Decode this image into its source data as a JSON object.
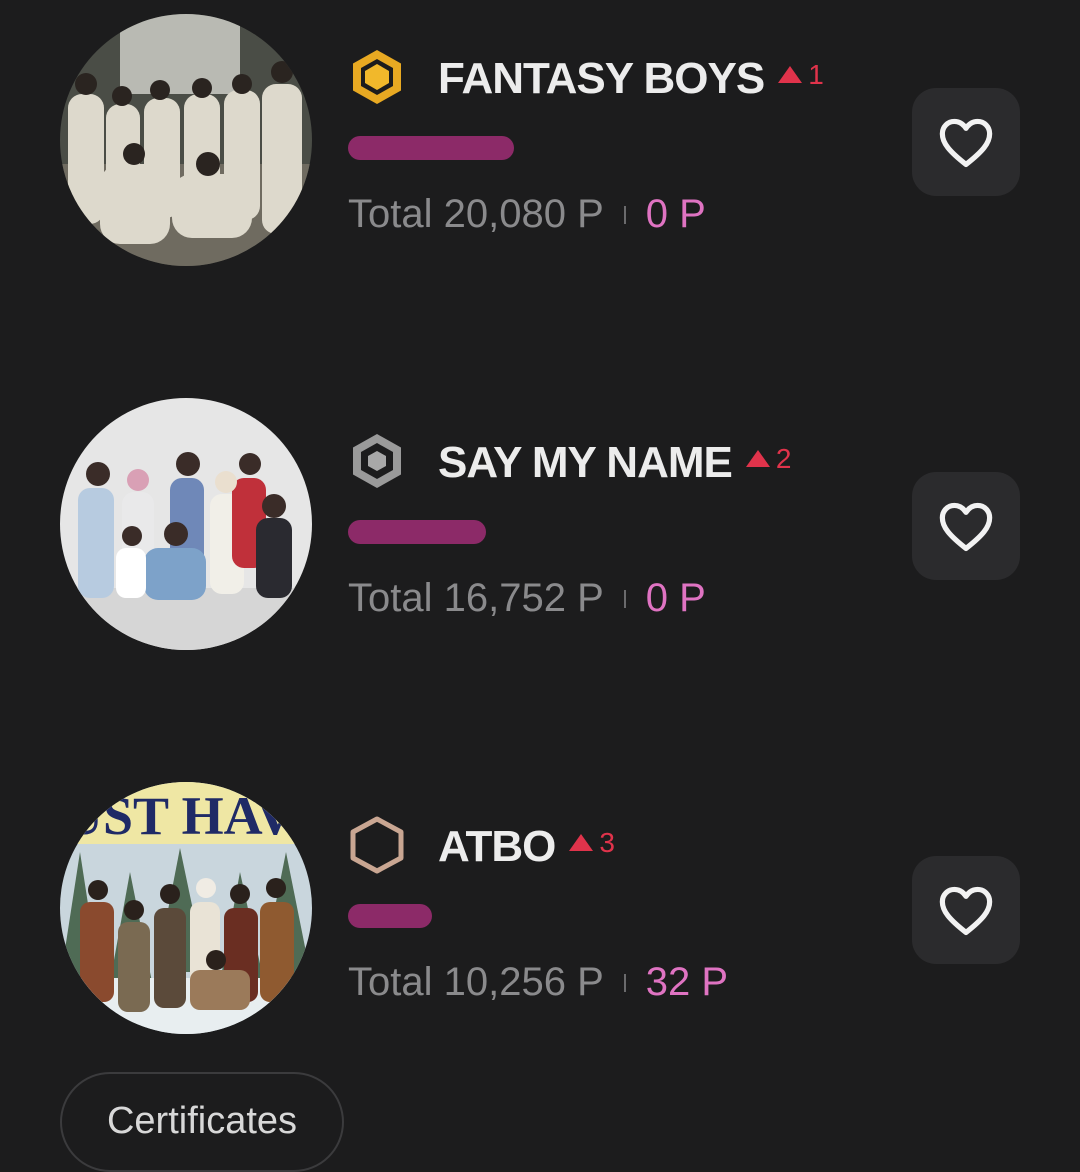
{
  "colors": {
    "background": "#1c1c1d",
    "bar": "#8c2a68",
    "rank_up": "#e0334b",
    "my_points": "#df73c2",
    "medal_gold": "#e8a922",
    "medal_silver": "#9a9a9a",
    "medal_bronze": "#c9a692"
  },
  "entries": [
    {
      "name": "FANTASY BOYS",
      "rank": "1",
      "medal_icon": "gold-hexagon-medal-icon",
      "bar_fill": 0.16,
      "total": "Total 20,080 P",
      "my_points": "0 P"
    },
    {
      "name": "SAY MY NAME",
      "rank": "2",
      "medal_icon": "silver-hexagon-medal-icon",
      "bar_fill": 0.135,
      "total": "Total 16,752 P",
      "my_points": "0 P"
    },
    {
      "name": "ATBO",
      "rank": "3",
      "medal_icon": "bronze-hexagon-medal-icon",
      "bar_fill": 0.085,
      "total": "Total 10,256 P",
      "my_points": "32 P",
      "photo_text": "UST HAVE"
    }
  ],
  "certificates_button": "Certificates"
}
